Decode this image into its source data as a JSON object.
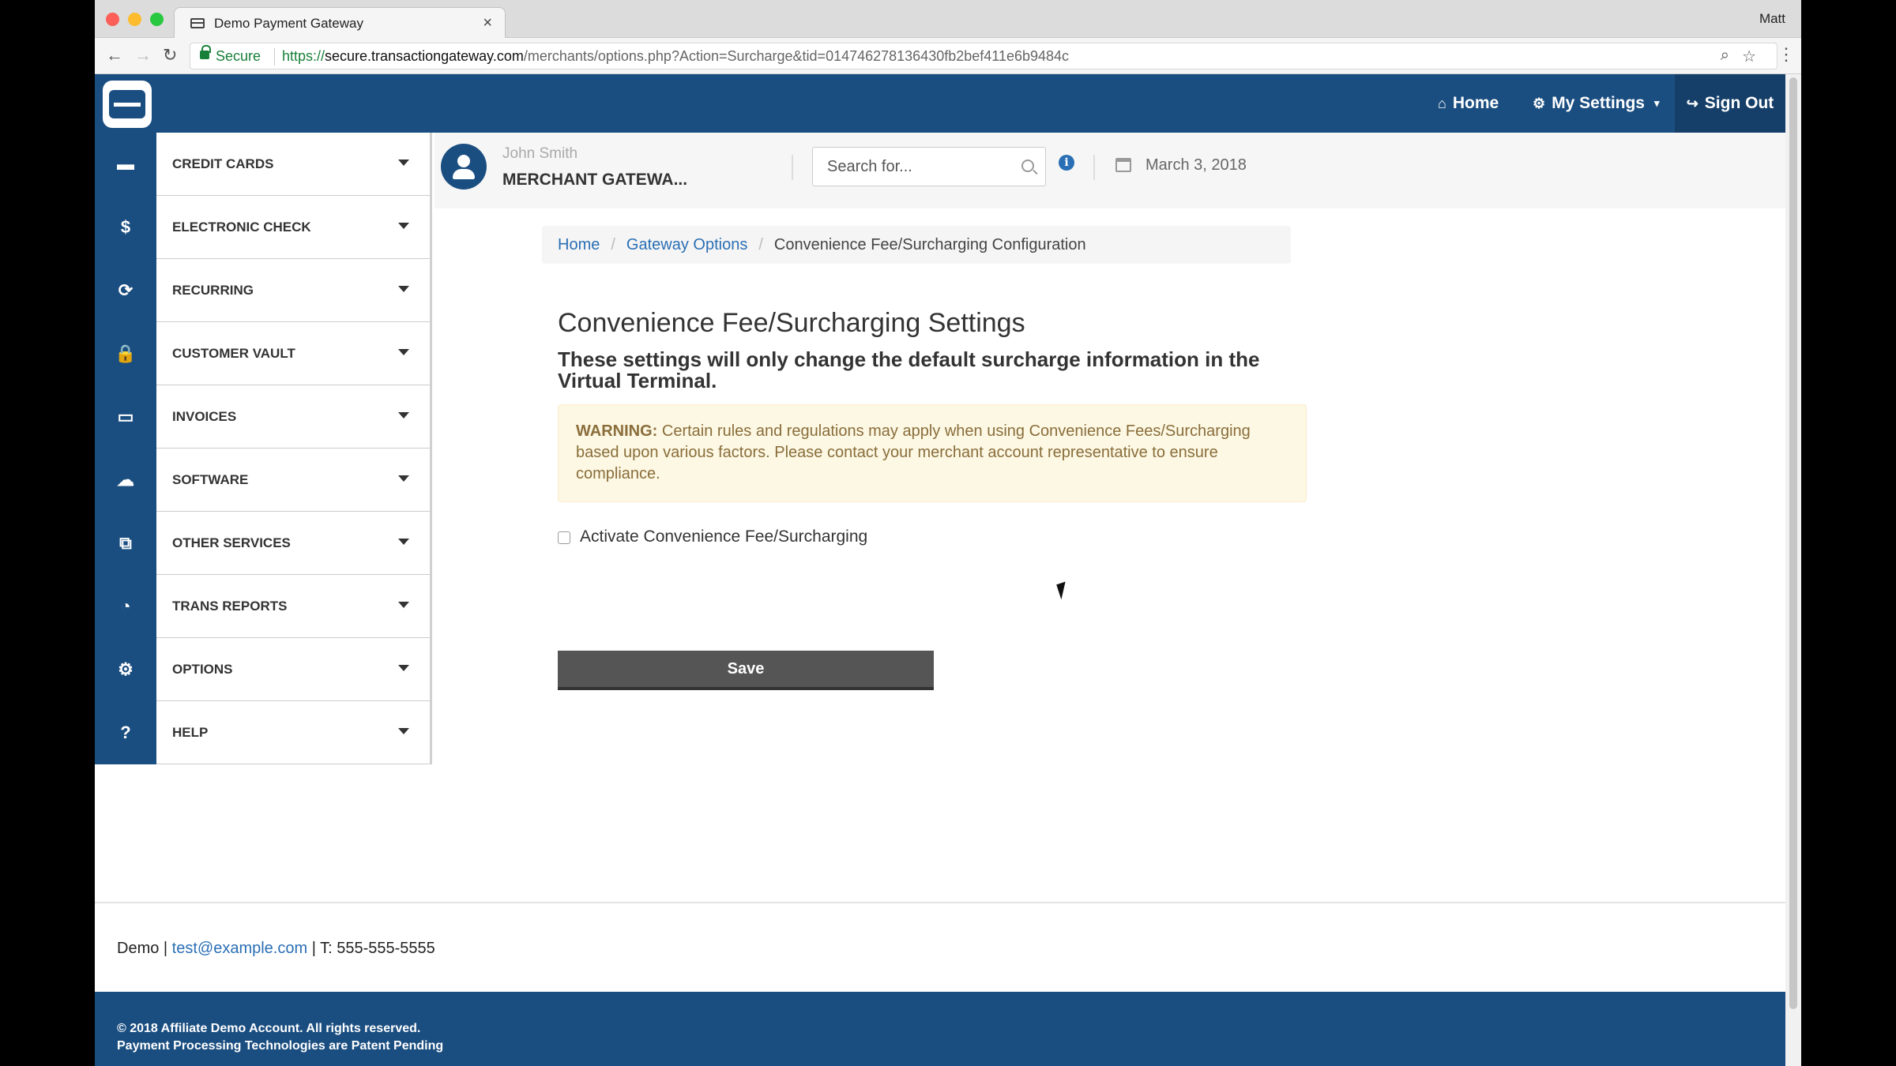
{
  "browser": {
    "tab_title": "Demo Payment Gateway",
    "tab_close": "×",
    "profile_name": "Matt",
    "secure_label": "Secure",
    "url_protocol": "https://",
    "url_host": "secure.transactiongateway.com",
    "url_path": "/merchants/options.php?Action=Surcharge&tid=014746278136430fb2bef411e6b9484c",
    "back_glyph": "←",
    "forward_glyph": "→",
    "reload_glyph": "↻",
    "zoom_glyph": "⌕",
    "star_glyph": "☆",
    "menu_glyph": "⋮"
  },
  "header": {
    "home_label": "Home",
    "home_icon": "⌂",
    "settings_label": "My Settings",
    "settings_icon": "⚙",
    "signout_label": "Sign Out",
    "signout_icon": "↪",
    "caret": "▾",
    "brand_color": "#1b4e80"
  },
  "sidebar": {
    "items": [
      {
        "label": "CREDIT CARDS",
        "icon": "▬"
      },
      {
        "label": "ELECTRONIC CHECK",
        "icon": "$"
      },
      {
        "label": "RECURRING",
        "icon": "⟳"
      },
      {
        "label": "CUSTOMER VAULT",
        "icon": "🔒"
      },
      {
        "label": "INVOICES",
        "icon": "▭"
      },
      {
        "label": "SOFTWARE",
        "icon": "☁"
      },
      {
        "label": "OTHER SERVICES",
        "icon": "⧉"
      },
      {
        "label": "TRANS REPORTS",
        "icon": "◔"
      },
      {
        "label": "OPTIONS",
        "icon": "⚙"
      },
      {
        "label": "HELP",
        "icon": "?"
      }
    ]
  },
  "user": {
    "name": "John Smith",
    "merchant": "MERCHANT GATEWA..."
  },
  "search": {
    "placeholder": "Search for..."
  },
  "info_icon_glyph": "i",
  "date": "March 3, 2018",
  "breadcrumb": {
    "home": "Home",
    "gateway_options": "Gateway Options",
    "current": "Convenience Fee/Surcharging Configuration",
    "sep": "/"
  },
  "main": {
    "title": "Convenience Fee/Surcharging Settings",
    "subtitle": "These settings will only change the default surcharge information in the Virtual Terminal.",
    "warning_label": "WARNING:",
    "warning_text": "Certain rules and regulations may apply when using Convenience Fees/Surcharging based upon various factors. Please contact your merchant account representative to ensure compliance.",
    "checkbox_label": "Activate Convenience Fee/Surcharging",
    "save_label": "Save"
  },
  "footer": {
    "company": "Demo |",
    "email": "test@example.com",
    "phone": "| T: 555-555-5555",
    "copyright": "© 2018 Affiliate Demo Account. All rights reserved.",
    "patent": "Payment Processing Technologies are Patent Pending"
  }
}
